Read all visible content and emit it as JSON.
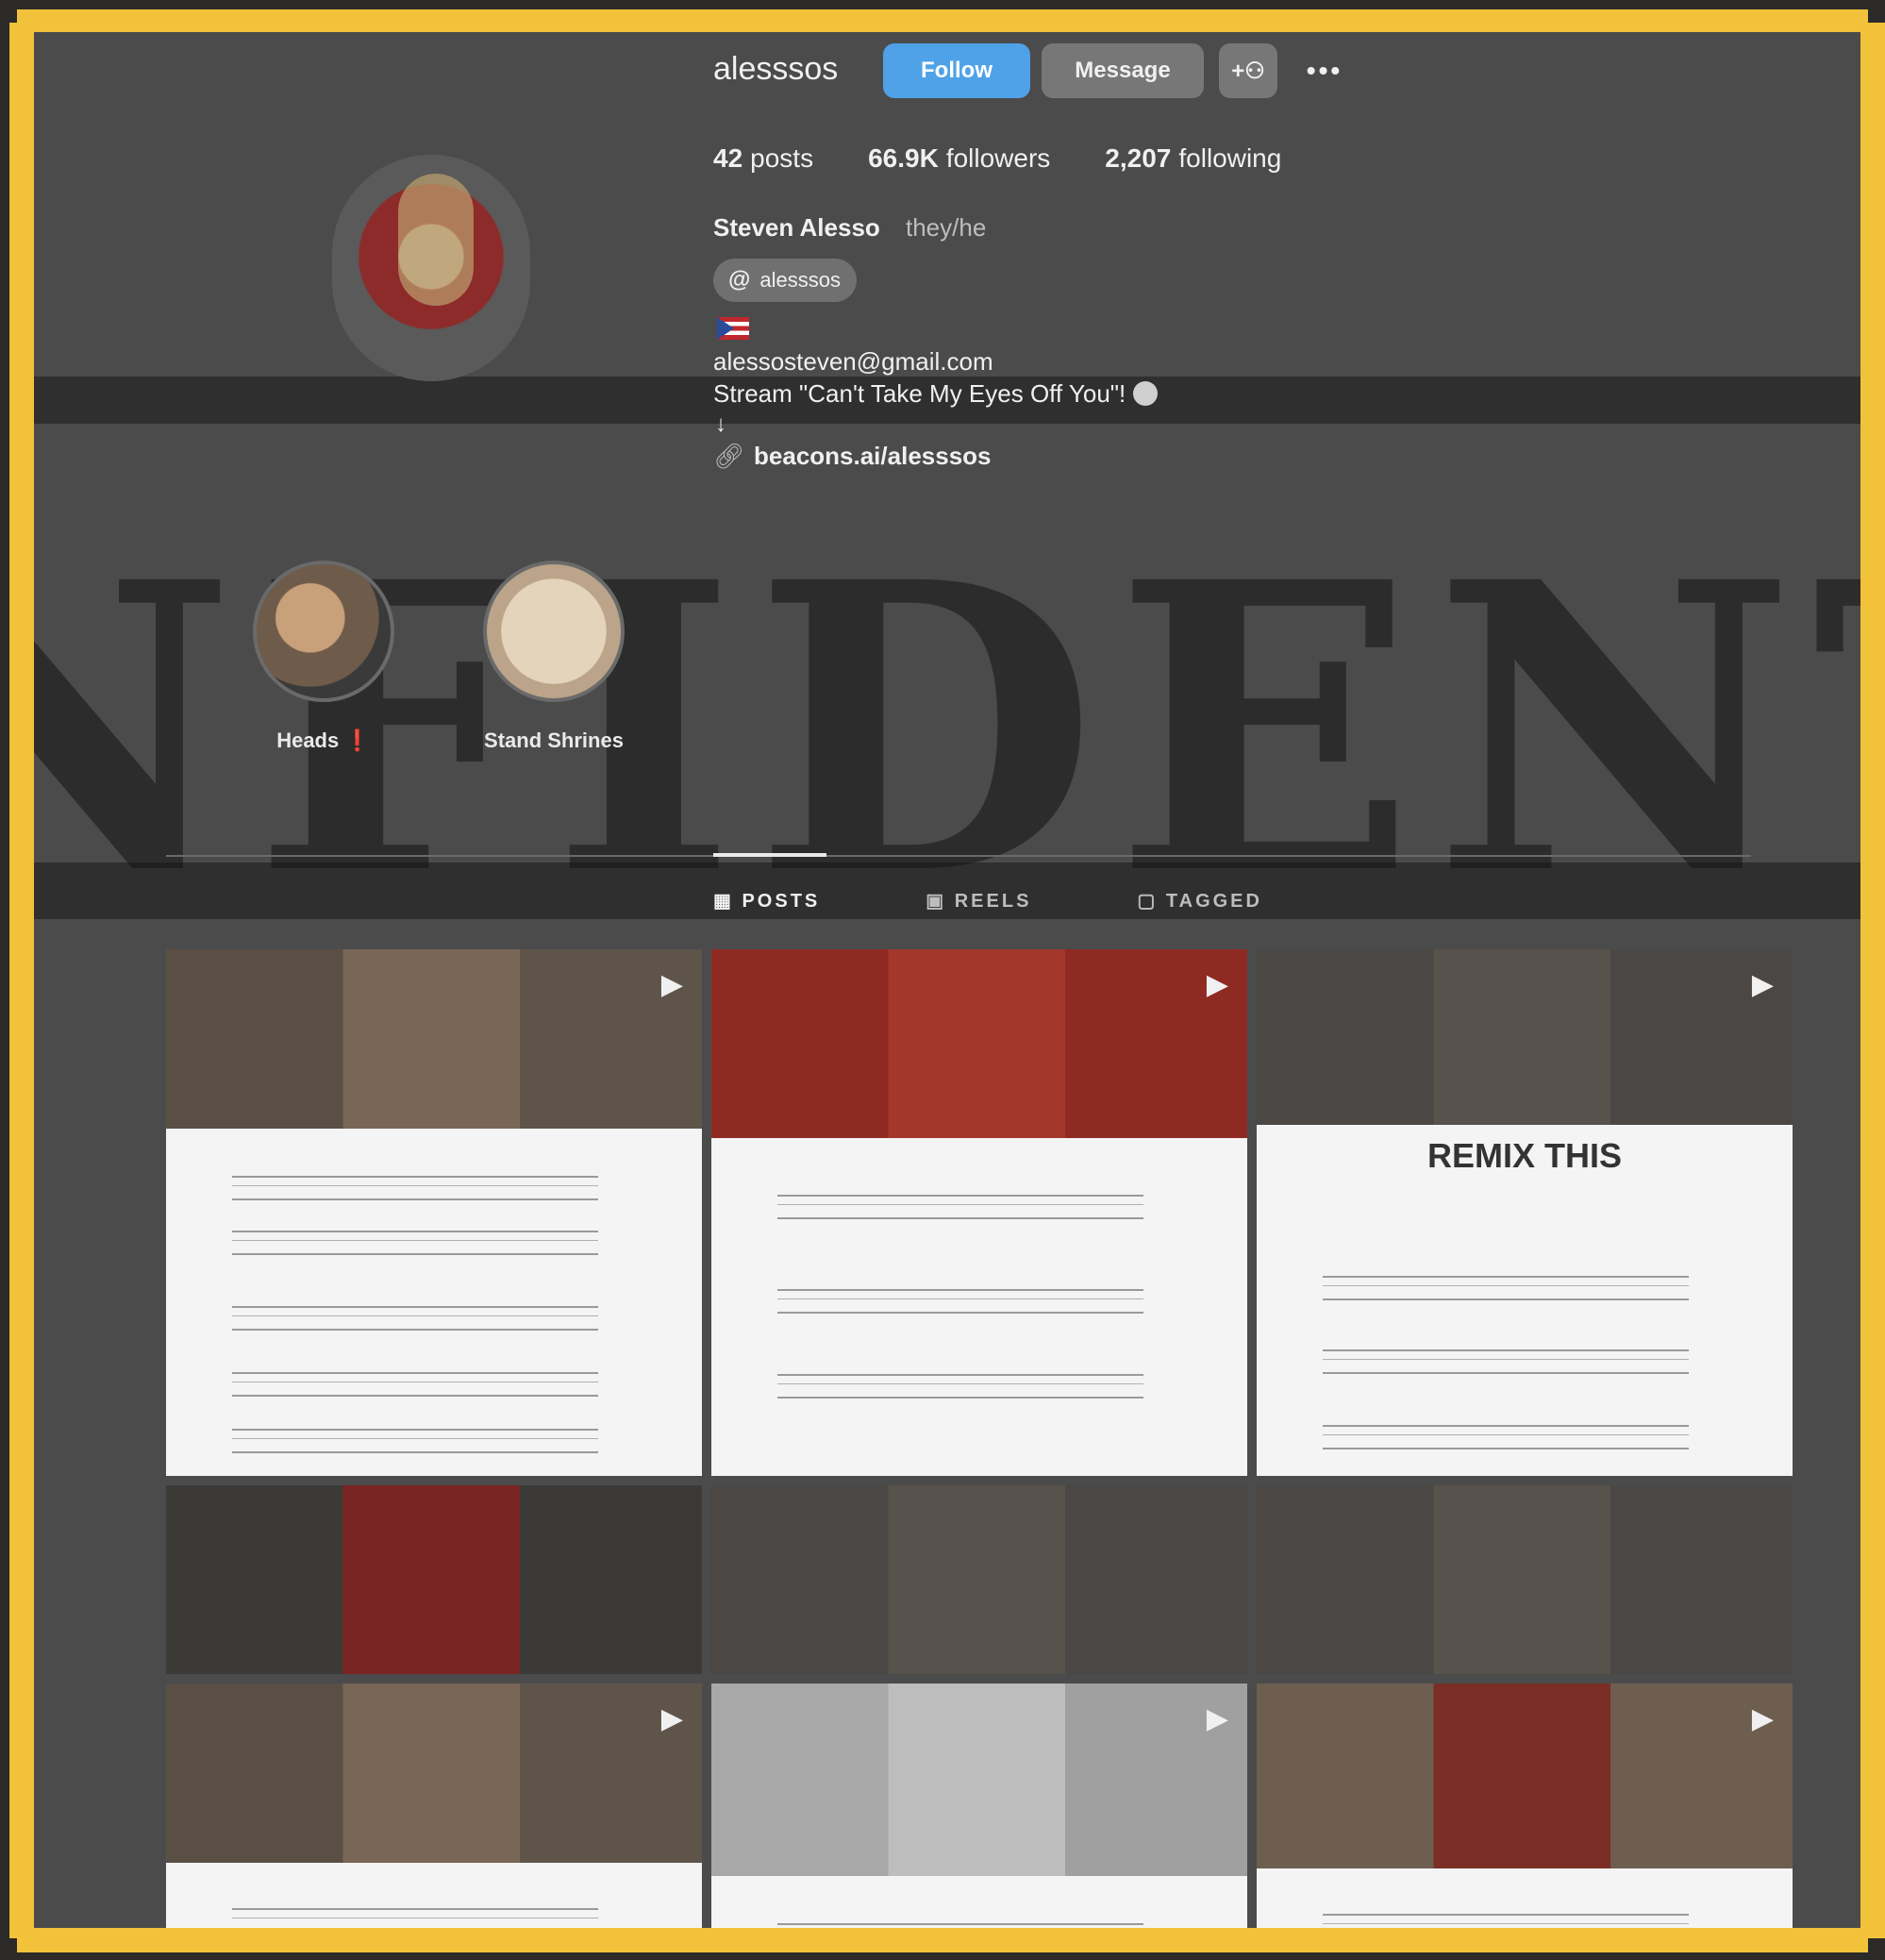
{
  "profile": {
    "username": "alesssos",
    "buttons": {
      "follow": "Follow",
      "message": "Message",
      "suggest_icon": "add-person-icon",
      "more": "•••"
    },
    "stats": [
      {
        "num": "42",
        "label": "posts"
      },
      {
        "num": "66.9K",
        "label": "followers"
      },
      {
        "num": "2,207",
        "label": "following"
      }
    ],
    "name": "Steven Alesso",
    "pronouns": "they/he",
    "threads_handle": "alesssos",
    "bio": {
      "email": "alessosteven@gmail.com",
      "stream": "Stream \"Can't Take My Eyes Off You\"!",
      "arrow": "↓",
      "link": "beacons.ai/alesssos"
    }
  },
  "highlights": [
    {
      "label": "Heads",
      "mark": "❗"
    },
    {
      "label": "Stand Shrines"
    }
  ],
  "tabs": [
    {
      "label": "POSTS",
      "icon": "▦"
    },
    {
      "label": "REELS",
      "icon": "▣"
    },
    {
      "label": "TAGGED",
      "icon": "▢"
    }
  ],
  "posts": {
    "remix_title": "REMIX THIS",
    "reel_icon": "▶"
  },
  "colors": {
    "frame": "#f2c23a",
    "follow": "#4fa2e8",
    "screen": "#4b4b4b"
  }
}
